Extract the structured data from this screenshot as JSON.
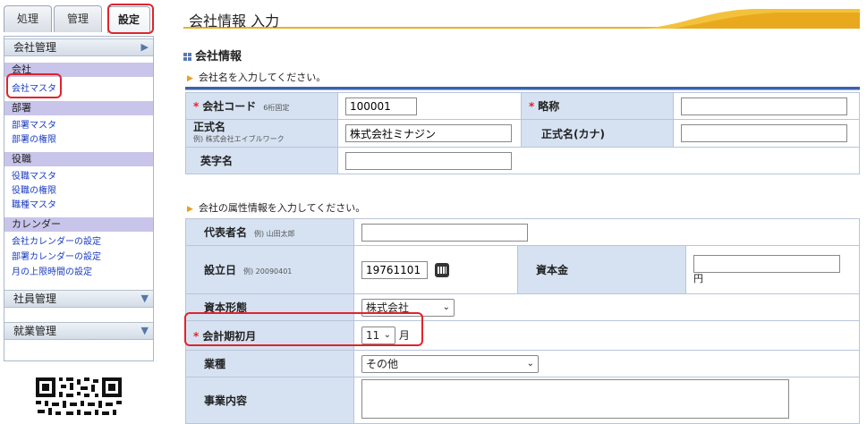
{
  "tabs": [
    {
      "label": "処理"
    },
    {
      "label": "管理"
    },
    {
      "label": "設定"
    }
  ],
  "sidebar": {
    "company_section": "会社管理",
    "categories": [
      {
        "title": "会社",
        "links": [
          "会社マスタ"
        ]
      },
      {
        "title": "部署",
        "links": [
          "部署マスタ",
          "部署の権限"
        ]
      },
      {
        "title": "役職",
        "links": [
          "役職マスタ",
          "役職の権限",
          "職種マスタ"
        ]
      },
      {
        "title": "カレンダー",
        "links": [
          "会社カレンダーの設定",
          "部署カレンダーの設定",
          "月の上限時間の設定"
        ]
      }
    ],
    "employee_section": "社員管理",
    "work_section": "就業管理"
  },
  "header": {
    "title": "会社情報 入力"
  },
  "section": {
    "title": "会社情報",
    "inst1": "会社名を入力してください。",
    "inst2": "会社の属性情報を入力してください。"
  },
  "form1": {
    "code_label": "会社コード",
    "code_note": "6桁固定",
    "code_value": "100001",
    "abbr_label": "略称",
    "abbr_value": "",
    "name_label": "正式名",
    "name_note": "例) 株式会社エイブルワーク",
    "name_value": "株式会社ミナジン",
    "kana_label": "正式名(カナ)",
    "kana_value": "",
    "eng_label": "英字名",
    "eng_value": ""
  },
  "form2": {
    "rep_label": "代表者名",
    "rep_note": "例) 山田太郎",
    "rep_value": "",
    "est_label": "設立日",
    "est_note": "例) 20090401",
    "est_value": "19761101",
    "capital_label": "資本金",
    "capital_unit": "円",
    "capital_value": "",
    "form_label": "資本形態",
    "form_value": "株式会社",
    "fiscal_label": "会計期初月",
    "fiscal_value": "11",
    "fiscal_unit": "月",
    "industry_label": "業種",
    "industry_value": "その他",
    "business_label": "事業内容"
  },
  "colors": {
    "accent_red": "#e0242b",
    "label_bg": "#d6e2f2",
    "category_bg": "#c8c4ea",
    "link": "#1a3cc0",
    "title_underline": "#e8b22a"
  }
}
